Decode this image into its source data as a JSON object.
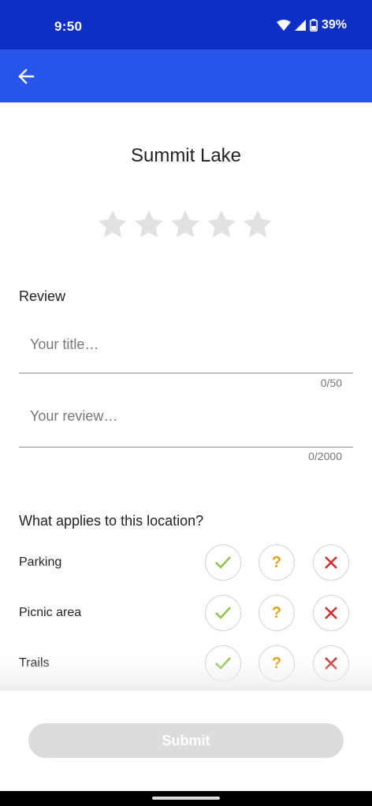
{
  "status_bar": {
    "time": "9:50",
    "battery": "39%",
    "icons": [
      "wifi-icon",
      "signal-icon",
      "battery-icon"
    ]
  },
  "app_bar": {
    "back_icon": "arrow-left-icon",
    "color": "#2755ec"
  },
  "place": {
    "name": "Summit Lake"
  },
  "rating": {
    "value": 0,
    "max": 5,
    "empty_color": "#e1e1e1"
  },
  "review": {
    "label": "Review",
    "title_placeholder": "Your title…",
    "title_value": "",
    "title_counter": "0/50",
    "body_placeholder": "Your review…",
    "body_value": "",
    "body_counter": "0/2000"
  },
  "amenities": {
    "heading": "What applies to this location?",
    "options": {
      "yes": "check-icon",
      "maybe": "?",
      "no": "close-icon"
    },
    "items": [
      {
        "label": "Parking"
      },
      {
        "label": "Picnic area"
      },
      {
        "label": "Trails"
      }
    ]
  },
  "submit": {
    "label": "Submit",
    "enabled": false
  }
}
